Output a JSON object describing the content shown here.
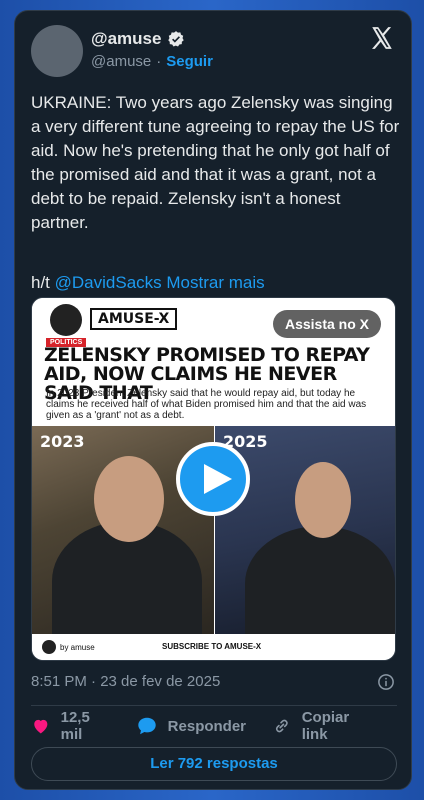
{
  "header": {
    "display_name": "@amuse",
    "handle": "@amuse",
    "separator": "·",
    "follow_label": "Seguir"
  },
  "tweet": {
    "text": "UKRAINE: Two years ago Zelensky was singing a very different tune agreeing to repay the US for aid. Now he's pretending that he only got half of the promised aid and that it was a grant, not a debt to be repaid. Zelensky isn't a honest partner.",
    "ht_prefix": "h/t",
    "mention": "@DavidSacks",
    "show_more": "Mostrar mais"
  },
  "media": {
    "brand_text": "AMUSE-X",
    "watch_label": "Assista no X",
    "tag": "POLITICS",
    "headline": "ZELENSKY PROMISED TO REPAY AID, NOW CLAIMS HE NEVER SAID THAT",
    "subtext": "In 2023 President Zelensky said that he would repay aid, but today he claims he received half of what Biden promised him and that the aid was given as a 'grant' not as a debt.",
    "year_left": "2023",
    "year_right": "2025",
    "by_label": "by amuse",
    "subscribe_label": "SUBSCRIBE TO AMUSE-X"
  },
  "meta": {
    "timestamp": "8:51 PM · 23 de fev de 2025"
  },
  "actions": {
    "likes": "12,5 mil",
    "reply": "Responder",
    "copy_link": "Copiar link"
  },
  "footer": {
    "read_replies": "Ler 792 respostas"
  },
  "colors": {
    "accent": "#1d9bf0",
    "card_bg": "#15202b",
    "like": "#f91880"
  },
  "icons": [
    "verified-badge-icon",
    "x-logo-icon",
    "play-icon",
    "info-icon",
    "heart-icon",
    "reply-icon",
    "link-icon"
  ]
}
